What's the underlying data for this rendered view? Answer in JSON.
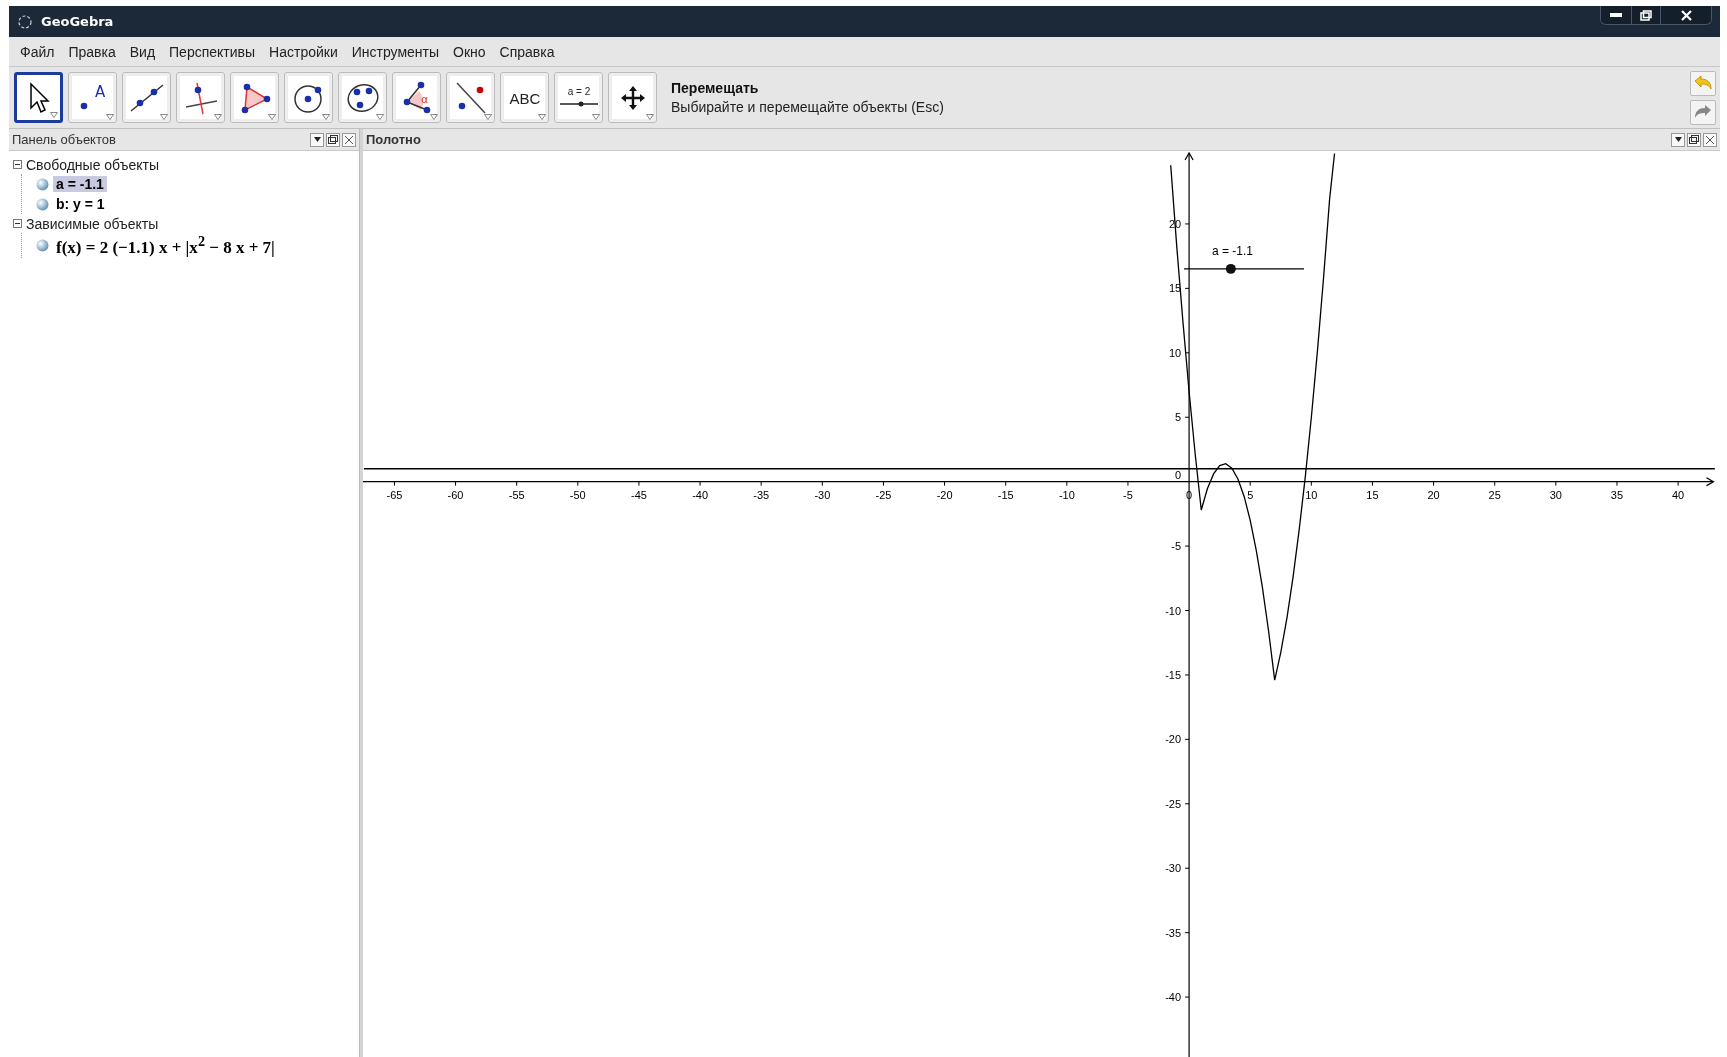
{
  "window": {
    "title": "GeoGebra"
  },
  "menu": [
    "Файл",
    "Правка",
    "Вид",
    "Перспективы",
    "Настройки",
    "Инструменты",
    "Окно",
    "Справка"
  ],
  "toolbar": {
    "tools": [
      {
        "kind": "select",
        "selected": true
      },
      {
        "kind": "point",
        "selected": false,
        "text": "A"
      },
      {
        "kind": "line",
        "selected": false
      },
      {
        "kind": "perpendicular",
        "selected": false
      },
      {
        "kind": "polygon",
        "selected": false
      },
      {
        "kind": "circle",
        "selected": false
      },
      {
        "kind": "conic",
        "selected": false
      },
      {
        "kind": "angle",
        "selected": false,
        "text": "α"
      },
      {
        "kind": "reflect",
        "selected": false
      },
      {
        "kind": "text",
        "selected": false,
        "text": "ABC"
      },
      {
        "kind": "slider",
        "selected": false,
        "text": "a = 2"
      },
      {
        "kind": "move",
        "selected": false
      }
    ],
    "tool_name": "Перемещать",
    "tool_help": "Выбирайте и перемещайте объекты (Esc)"
  },
  "algebra_panel": {
    "title": "Панель объектов",
    "groups": [
      {
        "label": "Свободные объекты",
        "expanded": true,
        "children": [
          {
            "label": "a = -1.1",
            "selected": true,
            "kind": "plain"
          },
          {
            "label": "b: y = 1",
            "selected": false,
            "kind": "plain"
          }
        ]
      },
      {
        "label": "Зависимые объекты",
        "expanded": true,
        "children": [
          {
            "label": "f(x) = 2 (−1.1) x + |x$^{2}$ − 8 x + 7|",
            "selected": false,
            "kind": "formula"
          }
        ]
      }
    ]
  },
  "graphics_panel": {
    "title": "Полотно",
    "slider": {
      "label": "a = -1.1",
      "level": 0.39
    },
    "origin_label": "0",
    "chart_data": {
      "type": "line",
      "xlim": [
        -67.57,
        43.06
      ],
      "ylim": [
        -44.65,
        25.66
      ],
      "xticks": [
        -65,
        -60,
        -55,
        -50,
        -45,
        -40,
        -35,
        -30,
        -25,
        -20,
        -15,
        -10,
        -5,
        0,
        5,
        10,
        15,
        20,
        25,
        30,
        35,
        40
      ],
      "yticks": [
        -40,
        -35,
        -30,
        -25,
        -20,
        -15,
        -10,
        -5,
        5,
        10,
        15,
        20
      ],
      "x": [
        -67.5,
        -1.5,
        -1,
        -0.5,
        0,
        0.5,
        1,
        1.5,
        2,
        2.5,
        3,
        3.5,
        4,
        4.5,
        5,
        5.5,
        6,
        6.5,
        7,
        7.5,
        8,
        8.5,
        9,
        9.5,
        10,
        10.5,
        11,
        11.5,
        11.9,
        43
      ],
      "series": [
        {
          "color": "#000000",
          "values": [
            null,
            24.55,
            18.2,
            12.35,
            7,
            2.15,
            -2.2,
            -0.55,
            0.6,
            1.25,
            1.4,
            1.05,
            0.2,
            -1.15,
            -3,
            -5.35,
            -8.2,
            -11.55,
            -15.4,
            -13.25,
            -10.6,
            -7.45,
            -3.8,
            0.35,
            5,
            10.15,
            15.8,
            21.95,
            25.47,
            null
          ]
        },
        {
          "color": "#000000",
          "values": [
            1,
            1,
            1,
            1,
            1,
            1,
            1,
            1,
            1,
            1,
            1,
            1,
            1,
            1,
            1,
            1,
            1,
            1,
            1,
            1,
            1,
            1,
            1,
            1,
            1,
            1,
            1,
            1,
            1,
            1
          ]
        }
      ]
    }
  }
}
